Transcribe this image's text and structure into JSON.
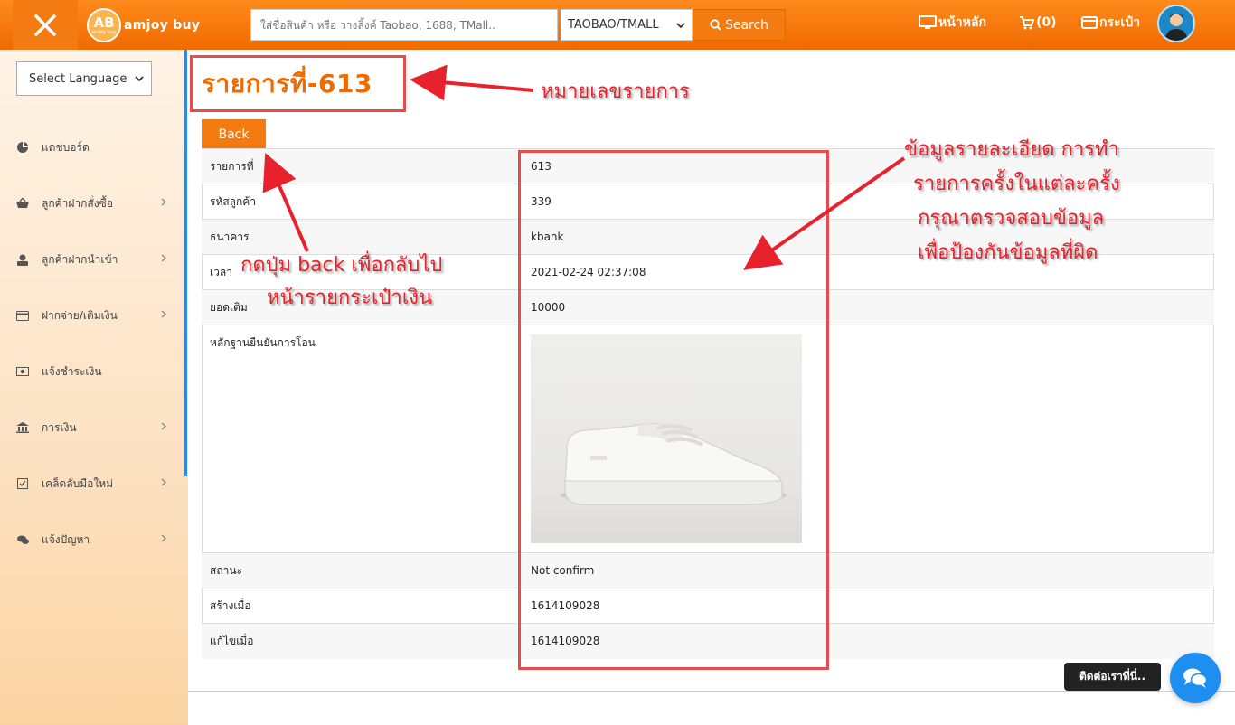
{
  "header": {
    "logo_text": "amjoy buy",
    "logo_mark": "AB",
    "logo_sub": "amjoy buy",
    "search_placeholder": "ใส่ชื่อสินค้า หรือ วางลิ้งค์ Taobao, 1688, TMall..",
    "source_selected": "TAOBAO/TMALL",
    "search_label": "Search",
    "nav_home": "หน้าหลัก",
    "nav_cart": "(0)",
    "nav_wallet": "กระเป๋า",
    "accent_color": "#f47a12"
  },
  "sidebar": {
    "language_select": "Select Language",
    "items": [
      {
        "label": "แดชบอร์ด",
        "icon": "dashboard-icon"
      },
      {
        "label": "ลูกค้าฝากสั่งซื้อ",
        "icon": "basket-icon"
      },
      {
        "label": "ลูกค้าฝากนำเข้า",
        "icon": "import-icon"
      },
      {
        "label": "ฝากจ่าย/เติมเงิน",
        "icon": "card-icon"
      },
      {
        "label": "แจ้งชำระเงิน",
        "icon": "money-icon"
      },
      {
        "label": "การเงิน",
        "icon": "bank-icon"
      },
      {
        "label": "เคล็ดลับมือใหม่",
        "icon": "checklist-icon"
      },
      {
        "label": "แจ้งปัญหา",
        "icon": "chat-bubble-icon"
      }
    ]
  },
  "main": {
    "title": "รายการที่-613",
    "back_label": "Back",
    "rows": [
      {
        "label": "รายการที่",
        "value": "613"
      },
      {
        "label": "รหัสลูกค้า",
        "value": "339"
      },
      {
        "label": "ธนาคาร",
        "value": "kbank"
      },
      {
        "label": "เวลา",
        "value": "2021-02-24 02:37:08"
      },
      {
        "label": "ยอดเติม",
        "value": "10000"
      },
      {
        "label": "หลักฐานยืนยันการโอน",
        "value": ""
      },
      {
        "label": "สถานะ",
        "value": "Not confirm"
      },
      {
        "label": "สร้างเมื่อ",
        "value": "1614109028"
      },
      {
        "label": "แก้ไขเมื่อ",
        "value": "1614109028"
      }
    ]
  },
  "annotations": {
    "title_note": "หมายเลขรายการ",
    "back_note_line1": "กดปุ่ม back เพื่อกลับไป",
    "back_note_line2": "หน้ารายกระเป๋าเงิน",
    "detail_note_line1": "ข้อมูลรายละเอียด การทำ",
    "detail_note_line2": "รายการครั้งในแต่ละครั้ง",
    "detail_note_line3": "กรุณาตรวจสอบข้อมูล",
    "detail_note_line4": "เพื่อป้องกันข้อมูลที่ผิด",
    "color": "#e8222c"
  },
  "contact": {
    "label": "ติดต่อเราที่นี่.."
  }
}
